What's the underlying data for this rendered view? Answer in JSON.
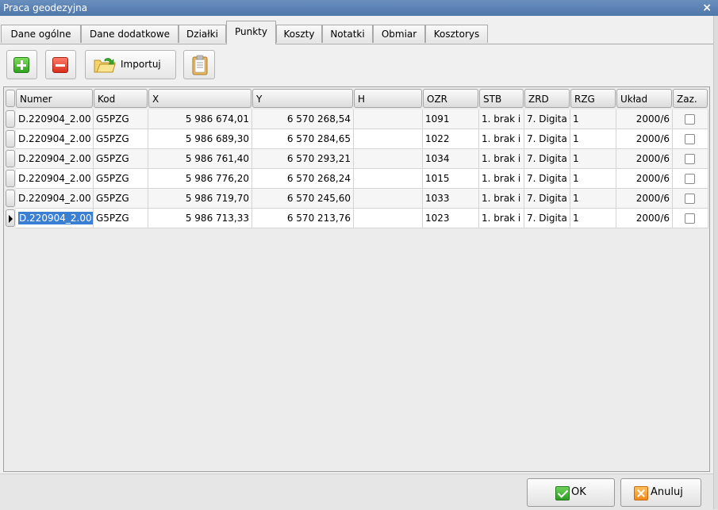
{
  "window": {
    "title": "Praca geodezyjna",
    "close_label": "×"
  },
  "tabs": [
    {
      "label": "Dane ogólne"
    },
    {
      "label": "Dane dodatkowe"
    },
    {
      "label": "Działki"
    },
    {
      "label": "Punkty",
      "active": true
    },
    {
      "label": "Koszty"
    },
    {
      "label": "Notatki"
    },
    {
      "label": "Obmiar"
    },
    {
      "label": "Kosztorys"
    }
  ],
  "toolbar": {
    "import_label": "Importuj"
  },
  "grid": {
    "columns": [
      "Numer",
      "Kod",
      "X",
      "Y",
      "H",
      "OZR",
      "STB",
      "ZRD",
      "RZG",
      "Układ",
      "Zaz."
    ],
    "rows": [
      {
        "numer": "D.220904_2.00",
        "kod": "G5PZG",
        "x": "5 986 674,01",
        "y": "6 570 268,54",
        "h": "",
        "ozr": "1091",
        "stb": "1. brak i",
        "zrd": "7. Digita",
        "rzg": "1",
        "uklad": "2000/6"
      },
      {
        "numer": "D.220904_2.00",
        "kod": "G5PZG",
        "x": "5 986 689,30",
        "y": "6 570 284,65",
        "h": "",
        "ozr": "1022",
        "stb": "1. brak i",
        "zrd": "7. Digita",
        "rzg": "1",
        "uklad": "2000/6"
      },
      {
        "numer": "D.220904_2.00",
        "kod": "G5PZG",
        "x": "5 986 761,40",
        "y": "6 570 293,21",
        "h": "",
        "ozr": "1034",
        "stb": "1. brak i",
        "zrd": "7. Digita",
        "rzg": "1",
        "uklad": "2000/6"
      },
      {
        "numer": "D.220904_2.00",
        "kod": "G5PZG",
        "x": "5 986 776,20",
        "y": "6 570 268,24",
        "h": "",
        "ozr": "1015",
        "stb": "1. brak i",
        "zrd": "7. Digita",
        "rzg": "1",
        "uklad": "2000/6"
      },
      {
        "numer": "D.220904_2.00",
        "kod": "G5PZG",
        "x": "5 986 719,70",
        "y": "6 570 245,60",
        "h": "",
        "ozr": "1033",
        "stb": "1. brak i",
        "zrd": "7. Digita",
        "rzg": "1",
        "uklad": "2000/6"
      },
      {
        "numer": "D.220904_2.00",
        "kod": "G5PZG",
        "x": "5 986 713,33",
        "y": "6 570 213,76",
        "h": "",
        "ozr": "1023",
        "stb": "1. brak i",
        "zrd": "7. Digita",
        "rzg": "1",
        "uklad": "2000/6"
      }
    ]
  },
  "buttons": {
    "ok_label": "OK",
    "cancel_label": "Anuluj"
  },
  "icons": {
    "add": "plus-icon",
    "remove": "minus-icon",
    "import": "folder-import-icon",
    "paste": "clipboard-icon",
    "ok": "check-icon",
    "cancel": "cross-icon",
    "current_row": "row-pointer-icon"
  },
  "colors": {
    "title_bar": "#5a81b3",
    "selection": "#3b7fd3",
    "ok_green": "#3aa82b",
    "cancel_orange": "#f0901f"
  }
}
